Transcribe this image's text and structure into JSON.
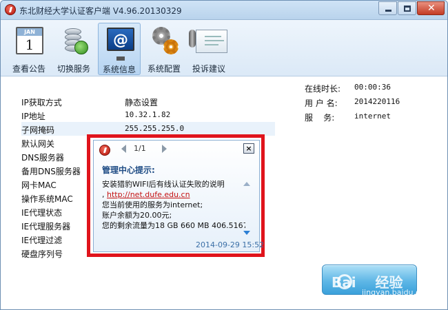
{
  "window": {
    "title": "东北财经大学认证客户端  V4.96.20130329"
  },
  "toolbar": {
    "items": [
      {
        "label": "查看公告",
        "icon": "calendar-icon",
        "calendar_month": "JAN",
        "calendar_day": "1"
      },
      {
        "label": "切换服务",
        "icon": "database-switch-icon"
      },
      {
        "label": "系统信息",
        "icon": "monitor-at-icon",
        "active": true
      },
      {
        "label": "系统配置",
        "icon": "gears-icon"
      },
      {
        "label": "投诉建议",
        "icon": "complaint-board-icon"
      }
    ]
  },
  "system_info": {
    "rows": [
      {
        "label": "IP获取方式",
        "value": "静态设置"
      },
      {
        "label": "IP地址",
        "value": "10.32.1.82"
      },
      {
        "label": "子网掩码",
        "value": "255.255.255.0"
      },
      {
        "label": "默认网关",
        "value": ""
      },
      {
        "label": "DNS服务器",
        "value": ""
      },
      {
        "label": "备用DNS服务器",
        "value": ""
      },
      {
        "label": "网卡MAC",
        "value": ""
      },
      {
        "label": "操作系统MAC",
        "value": ""
      },
      {
        "label": "IE代理状态",
        "value": ""
      },
      {
        "label": "IE代理服务器",
        "value": ""
      },
      {
        "label": "IE代理过滤",
        "value": ""
      },
      {
        "label": "硬盘序列号",
        "value": ""
      }
    ]
  },
  "status": {
    "online_time_label": "在线时长:",
    "online_time_value": "00:00:36",
    "username_label": "用 户 名:",
    "username_value": "2014220116",
    "service_label": "服    务:",
    "service_value": "internet"
  },
  "popup": {
    "page": "1/1",
    "close_glyph": "×",
    "title": "管理中心提示:",
    "lines": [
      "安装猎豹WIFI后有线认证失败的说明",
      "您当前使用的服务为internet;",
      "账户余额为20.00元;",
      "您的剩余流量为18 GB 660 MB 406.5167"
    ],
    "link_prefix": ",",
    "link": "http://net.dufe.edu.cn",
    "date": "2014-09-29 15:52"
  },
  "watermark": {
    "brand": "Bai    经验",
    "sub": "jingyan.baidu.com"
  },
  "colors": {
    "highlight_frame": "#e0141c",
    "link": "#c41010",
    "popup_title": "#1d4b84"
  }
}
